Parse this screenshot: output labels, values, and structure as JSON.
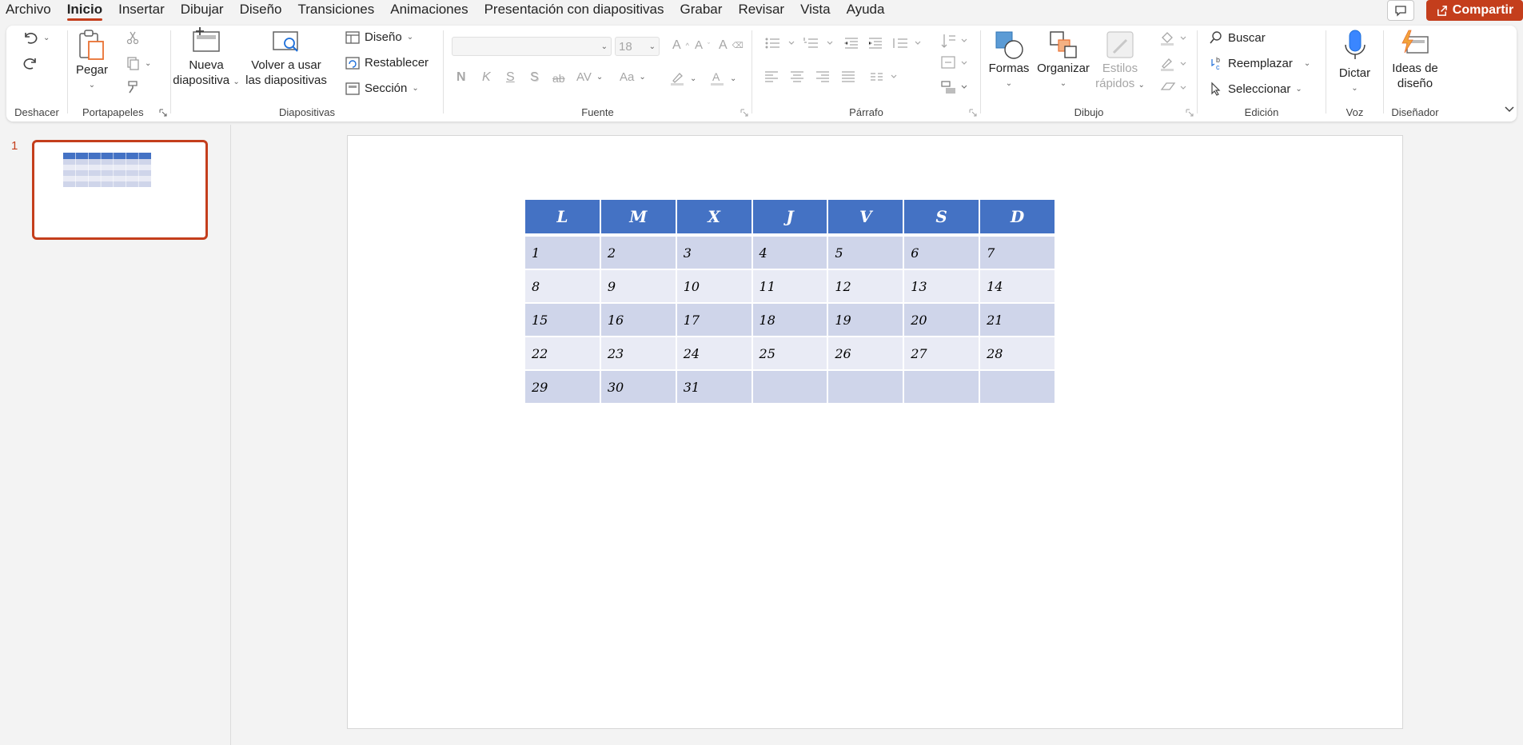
{
  "menu": {
    "tabs": [
      "Archivo",
      "Inicio",
      "Insertar",
      "Dibujar",
      "Diseño",
      "Transiciones",
      "Animaciones",
      "Presentación con diapositivas",
      "Grabar",
      "Revisar",
      "Vista",
      "Ayuda"
    ],
    "active": "Inicio",
    "share_label": "Compartir"
  },
  "ribbon": {
    "undo_group": {
      "label": "Deshacer"
    },
    "clipboard": {
      "label": "Portapapeles",
      "paste_label": "Pegar"
    },
    "slides": {
      "label": "Diapositivas",
      "new_slide_line1": "Nueva",
      "new_slide_line2": "diapositiva",
      "reuse_line1": "Volver a usar",
      "reuse_line2": "las diapositivas",
      "layout": "Diseño",
      "reset": "Restablecer",
      "section": "Sección"
    },
    "font": {
      "label": "Fuente",
      "font_name": "",
      "font_size": "18",
      "bold": "N",
      "italic": "K",
      "underline": "S",
      "shadow": "S",
      "strike": "ab",
      "spacing": "AV",
      "case": "Aa"
    },
    "paragraph": {
      "label": "Párrafo"
    },
    "drawing": {
      "label": "Dibujo",
      "shapes": "Formas",
      "arrange": "Organizar",
      "quick_styles_line1": "Estilos",
      "quick_styles_line2": "rápidos"
    },
    "editing": {
      "label": "Edición",
      "find": "Buscar",
      "replace": "Reemplazar",
      "select": "Seleccionar"
    },
    "voice": {
      "label": "Voz",
      "dictate": "Dictar"
    },
    "designer": {
      "label": "Diseñador",
      "ideas_line1": "Ideas de",
      "ideas_line2": "diseño"
    }
  },
  "thumbnails": {
    "slide_number": "1"
  },
  "calendar": {
    "days": [
      "L",
      "M",
      "X",
      "J",
      "V",
      "S",
      "D"
    ],
    "rows": [
      [
        "1",
        "2",
        "3",
        "4",
        "5",
        "6",
        "7"
      ],
      [
        "8",
        "9",
        "10",
        "11",
        "12",
        "13",
        "14"
      ],
      [
        "15",
        "16",
        "17",
        "18",
        "19",
        "20",
        "21"
      ],
      [
        "22",
        "23",
        "24",
        "25",
        "26",
        "27",
        "28"
      ],
      [
        "29",
        "30",
        "31",
        "",
        "",
        "",
        ""
      ]
    ]
  },
  "colors": {
    "accent": "#c43e1c",
    "table_header": "#4472c4",
    "table_band_dark": "#cfd5ea",
    "table_band_light": "#e9ebf5"
  }
}
